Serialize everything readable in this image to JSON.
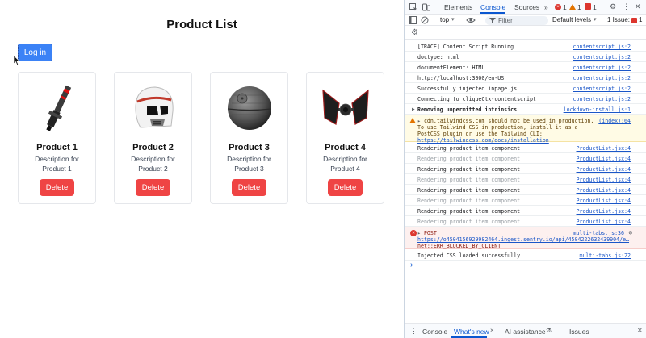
{
  "app": {
    "title": "Product List",
    "login_label": "Log in",
    "products": [
      {
        "name": "Product 1",
        "description": "Description for Product 1",
        "delete_label": "Delete",
        "image": "red-lightsaber-image"
      },
      {
        "name": "Product 2",
        "description": "Description for Product 2",
        "delete_label": "Delete",
        "image": "stormtrooper-helmet-image"
      },
      {
        "name": "Product 3",
        "description": "Description for Product 3",
        "delete_label": "Delete",
        "image": "death-star-image"
      },
      {
        "name": "Product 4",
        "description": "Description for Product 4",
        "delete_label": "Delete",
        "image": "tie-fighter-image"
      }
    ]
  },
  "devtools": {
    "tabs": {
      "elements": "Elements",
      "console": "Console",
      "sources": "Sources",
      "more": "»"
    },
    "counts": {
      "errors": "1",
      "warnings": "1",
      "issues_top": "1"
    },
    "toolbar": {
      "context": "top",
      "filter_placeholder": "Filter",
      "levels": "Default levels",
      "issues": "1 Issue:",
      "issues_count": "1"
    },
    "logs": [
      {
        "msg": "[TRACE] Content Script Running",
        "src": "contentscript.js:2",
        "kind": "info"
      },
      {
        "msg": "doctype: html",
        "src": "contentscript.js:2",
        "kind": "info"
      },
      {
        "msg": "documentElement: HTML",
        "src": "contentscript.js:2",
        "kind": "info"
      },
      {
        "msg": "http://localhost:3000/en-US",
        "src": "contentscript.js:2",
        "kind": "link"
      },
      {
        "msg": "Successfully injected inpage.js",
        "src": "contentscript.js:2",
        "kind": "info"
      },
      {
        "msg": "Connecting to cliqueCtx-contentscript",
        "src": "contentscript.js:2",
        "kind": "info"
      },
      {
        "msg": "Removing unpermitted intrinsics",
        "src": "lockdown-install.js:1",
        "kind": "group"
      }
    ],
    "warning": {
      "prefix": "cdn.tailwindcss.com should not be used in production. To use Tailwind CSS in production, install it as a PostCSS plugin or use the Tailwind CLI:",
      "link": "https://tailwindcss.com/docs/installation",
      "src": "(index):64"
    },
    "render_logs": [
      {
        "msg": "Rendering product item component",
        "src": "ProductList.jsx:4",
        "kind": "info"
      },
      {
        "msg": "Rendering product item component",
        "src": "ProductList.jsx:4",
        "kind": "grey"
      },
      {
        "msg": "Rendering product item component",
        "src": "ProductList.jsx:4",
        "kind": "info"
      },
      {
        "msg": "Rendering product item component",
        "src": "ProductList.jsx:4",
        "kind": "grey"
      },
      {
        "msg": "Rendering product item component",
        "src": "ProductList.jsx:4",
        "kind": "info"
      },
      {
        "msg": "Rendering product item component",
        "src": "ProductList.jsx:4",
        "kind": "grey"
      },
      {
        "msg": "Rendering product item component",
        "src": "ProductList.jsx:4",
        "kind": "info"
      },
      {
        "msg": "Rendering product item component",
        "src": "ProductList.jsx:4",
        "kind": "grey"
      }
    ],
    "error": {
      "label": "POST",
      "url": "https://o4504156929982464.ingest.sentry.io/api/4504222632439904/e…",
      "detail": "net::ERR_BLOCKED_BY_CLIENT",
      "src": "multi-tabs.js:36"
    },
    "final_log": {
      "msg": "Injected CSS loaded successfully",
      "src": "multi-tabs.js:22"
    },
    "prompt": "›",
    "drawer": {
      "console": "Console",
      "whats_new": "What's new",
      "ai": "AI assistance",
      "issues": "Issues"
    }
  },
  "colors": {
    "primary": "#3b82f6",
    "danger": "#ef4444",
    "devtools_accent": "#0b57d0"
  }
}
